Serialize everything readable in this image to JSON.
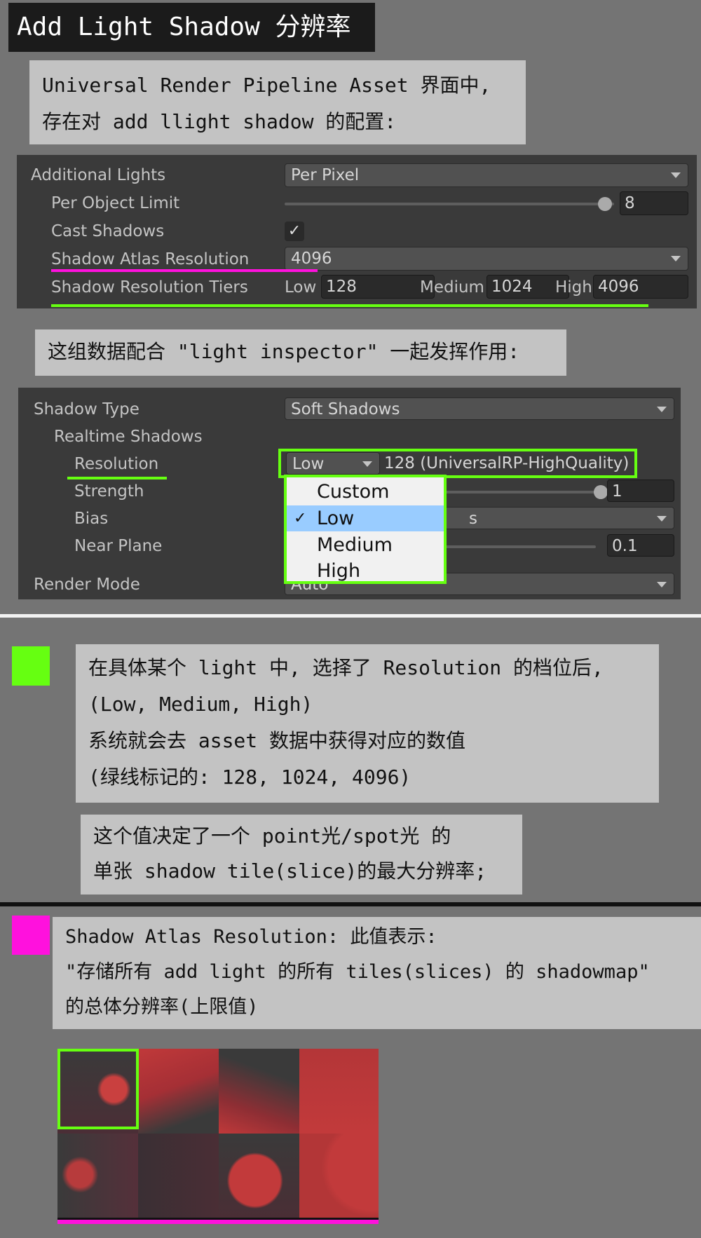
{
  "title": "Add Light Shadow 分辨率",
  "note1": {
    "line1": "Universal Render Pipeline Asset 界面中,",
    "line2": "存在对 add llight shadow 的配置:"
  },
  "asset_panel": {
    "additional_lights": {
      "label": "Additional Lights",
      "value": "Per Pixel"
    },
    "per_object_limit": {
      "label": "Per Object Limit",
      "value": "8"
    },
    "cast_shadows": {
      "label": "Cast Shadows",
      "checked": true,
      "check_glyph": "✓"
    },
    "shadow_atlas_resolution": {
      "label": "Shadow Atlas Resolution",
      "value": "4096"
    },
    "shadow_resolution_tiers": {
      "label": "Shadow Resolution Tiers",
      "low_label": "Low",
      "low_value": "128",
      "medium_label": "Medium",
      "medium_value": "1024",
      "high_label": "High",
      "high_value": "4096"
    }
  },
  "note2": "这组数据配合 \"light inspector\" 一起发挥作用:",
  "light_panel": {
    "shadow_type": {
      "label": "Shadow Type",
      "value": "Soft Shadows"
    },
    "realtime_shadows_label": "Realtime Shadows",
    "resolution": {
      "label": "Resolution",
      "value": "Low",
      "info": "128 (UniversalRP-HighQuality)"
    },
    "strength": {
      "label": "Strength",
      "value": "1"
    },
    "bias": {
      "label": "Bias",
      "value_fragment": "s"
    },
    "near_plane": {
      "label": "Near Plane",
      "value": "0.1"
    },
    "render_mode": {
      "label": "Render Mode",
      "value_fragment": "Auto"
    }
  },
  "dropdown": {
    "options": [
      "Custom",
      "Low",
      "Medium",
      "High"
    ],
    "selected": "Low",
    "check_glyph": "✓"
  },
  "note3": {
    "line1": "在具体某个 light 中, 选择了 Resolution 的档位后,",
    "line2": "(Low, Medium, High)",
    "line3": "系统就会去 asset 数据中获得对应的数值",
    "line4": "(绿线标记的: 128, 1024, 4096)"
  },
  "note4": {
    "line1": "这个值决定了一个 point光/spot光 的",
    "line2": "单张 shadow tile(slice)的最大分辨率;"
  },
  "note5": {
    "line1": "Shadow Atlas Resolution: 此值表示:",
    "line2": "\"存储所有 add light 的所有 tiles(slices) 的 shadowmap\"",
    "line3": "的总体分辨率(上限值)"
  },
  "colors": {
    "green": "#66ff11",
    "magenta": "#ff11dd",
    "selected_highlight": "#99ccff",
    "unity_panel": "#3a3a3a"
  },
  "icons": {
    "dropdown_arrow": "chevron-down-icon",
    "checkmark": "check-icon",
    "slider_knob": "slider-knob-icon"
  }
}
